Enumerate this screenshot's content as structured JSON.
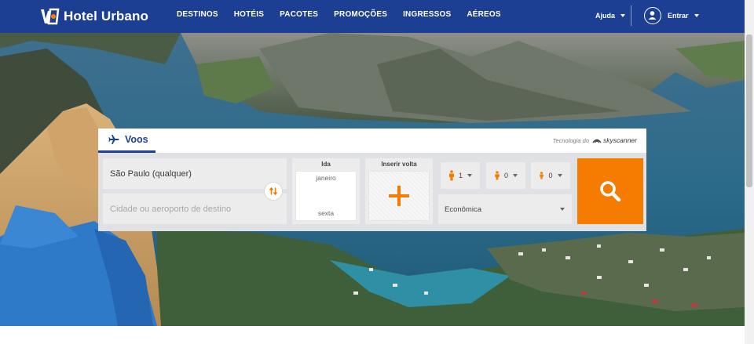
{
  "header": {
    "brand": "Hotel Urbano",
    "nav": [
      {
        "label": "DESTINOS"
      },
      {
        "label": "HOTÉIS"
      },
      {
        "label": "PACOTES"
      },
      {
        "label": "PROMOÇÕES"
      },
      {
        "label": "INGRESSOS"
      },
      {
        "label": "AÉREOS"
      }
    ],
    "help_label": "Ajuda",
    "login_label": "Entrar"
  },
  "search": {
    "tab_label": "Voos",
    "powered_prefix": "Tecnologia do",
    "powered_brand": "skyscanner",
    "origin_value": "São Paulo (qualquer)",
    "destination_placeholder": "Cidade ou aeroporto de destino",
    "depart": {
      "title": "Ida",
      "month": "janeiro",
      "weekday": "sexta"
    },
    "return_title": "Inserir volta",
    "passengers": [
      {
        "type": "adult",
        "count": "1"
      },
      {
        "type": "child",
        "count": "0"
      },
      {
        "type": "infant",
        "count": "0"
      }
    ],
    "cabin_class": "Econômica"
  },
  "colors": {
    "header_bg": "#1c3f94",
    "accent_orange": "#f57c00",
    "widget_bg": "#dfe1e5"
  }
}
